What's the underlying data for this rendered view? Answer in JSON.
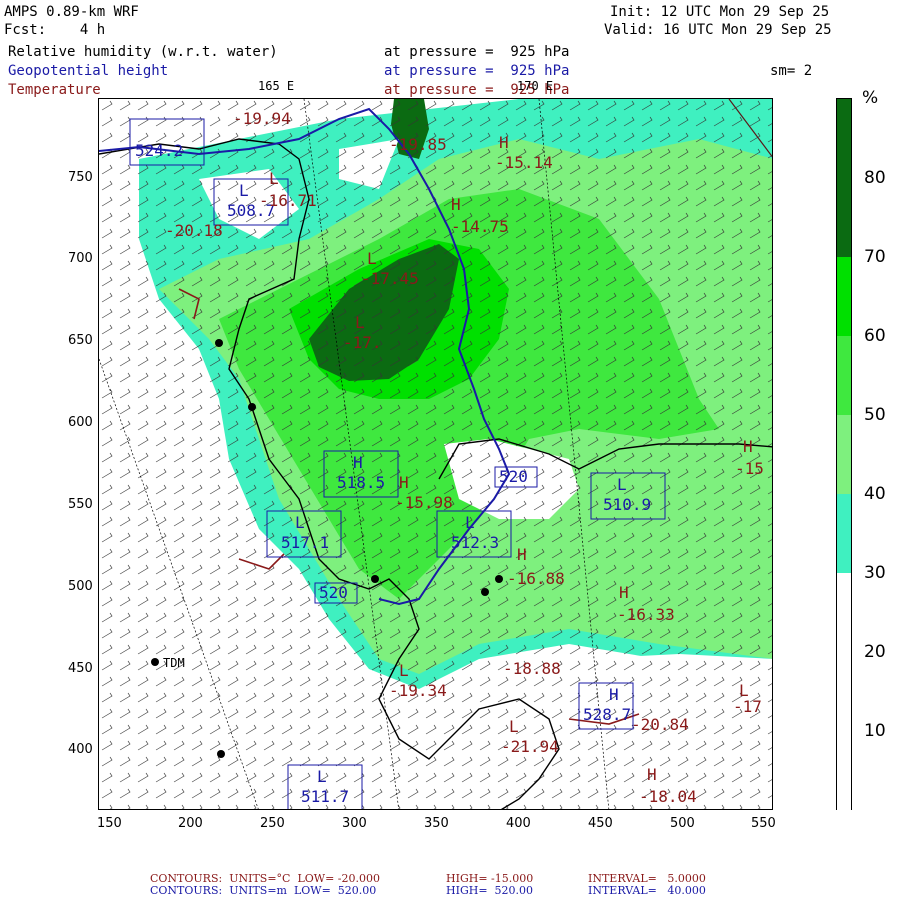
{
  "header": {
    "product": "AMPS 0.89-km WRF",
    "init": "Init: 12 UTC Mon 29 Sep 25",
    "fcst": "Fcst:    4 h",
    "valid": "Valid: 16 UTC Mon 29 Sep 25",
    "fields": [
      {
        "name": "Relative humidity (w.r.t. water)",
        "level": "at pressure =  925 hPa",
        "color": "#000000"
      },
      {
        "name": "Geopotential height",
        "level": "at pressure =  925 hPa",
        "color": "#1a1aa6"
      },
      {
        "name": "Temperature",
        "level": "at pressure =  925 hPa",
        "color": "#8a1a1a"
      }
    ],
    "smoothing": "sm= 2",
    "lon_label_165": "165 E",
    "lon_label_170": "170 E"
  },
  "colorbar": {
    "unit": "%",
    "ticks": [
      "80",
      "70",
      "60",
      "50",
      "40",
      "30",
      "20",
      "10"
    ],
    "segments": [
      {
        "range": "70-90",
        "color": "#0b6b12"
      },
      {
        "range": "60-70",
        "color": "#00e000"
      },
      {
        "range": "50-60",
        "color": "#3fe83f"
      },
      {
        "range": "40-50",
        "color": "#7ef07e"
      },
      {
        "range": "30-40",
        "color": "#3ff0c0"
      },
      {
        "range": "0-30",
        "color": "#ffffff"
      }
    ]
  },
  "axes": {
    "x_ticks": [
      "150",
      "200",
      "250",
      "300",
      "350",
      "400",
      "450",
      "500",
      "550"
    ],
    "y_ticks": [
      "750",
      "700",
      "650",
      "600",
      "550",
      "500",
      "450",
      "400"
    ]
  },
  "stations": [
    {
      "name": "TDM"
    }
  ],
  "labels": {
    "temperature_extrema": [
      {
        "kind": "",
        "value": "-19.94"
      },
      {
        "kind": "L",
        "value": "-16.71"
      },
      {
        "kind": "",
        "value": "-20.18"
      },
      {
        "kind": "",
        "value": "-19.85"
      },
      {
        "kind": "H",
        "value": "-15.14"
      },
      {
        "kind": "H",
        "value": "-14.75"
      },
      {
        "kind": "L",
        "value": "-17.45"
      },
      {
        "kind": "L",
        "value": "-17."
      },
      {
        "kind": "H",
        "value": "-15.98"
      },
      {
        "kind": "H",
        "value": "-16.88"
      },
      {
        "kind": "H",
        "value": "-16.33"
      },
      {
        "kind": "",
        "value": "-18.88"
      },
      {
        "kind": "L",
        "value": "-19.34"
      },
      {
        "kind": "L",
        "value": "-21.94"
      },
      {
        "kind": "",
        "value": "-20.84"
      },
      {
        "kind": "H",
        "value": "-18.04"
      },
      {
        "kind": "L",
        "value": "-17"
      },
      {
        "kind": "H",
        "value": "-15"
      }
    ],
    "height_extrema": [
      {
        "kind": "",
        "value": "524.2"
      },
      {
        "kind": "L",
        "value": "508.7"
      },
      {
        "kind": "H",
        "value": "518.5"
      },
      {
        "kind": "L",
        "value": "517.1"
      },
      {
        "kind": "L",
        "value": "512.3"
      },
      {
        "kind": "L",
        "value": "510.9"
      },
      {
        "kind": "H",
        "value": "528.7"
      },
      {
        "kind": "L",
        "value": "511.7"
      }
    ],
    "contour_values": [
      "520",
      "520"
    ]
  },
  "footer": {
    "temp": {
      "contours": "CONTOURS:  UNITS=°C  LOW= -20.000",
      "high": "HIGH= -15.000",
      "interval": "INTERVAL=   5.0000"
    },
    "height": {
      "contours": "CONTOURS:  UNITS=m  LOW=  520.00",
      "high": "HIGH=  520.00",
      "interval": "INTERVAL=   40.000"
    }
  }
}
